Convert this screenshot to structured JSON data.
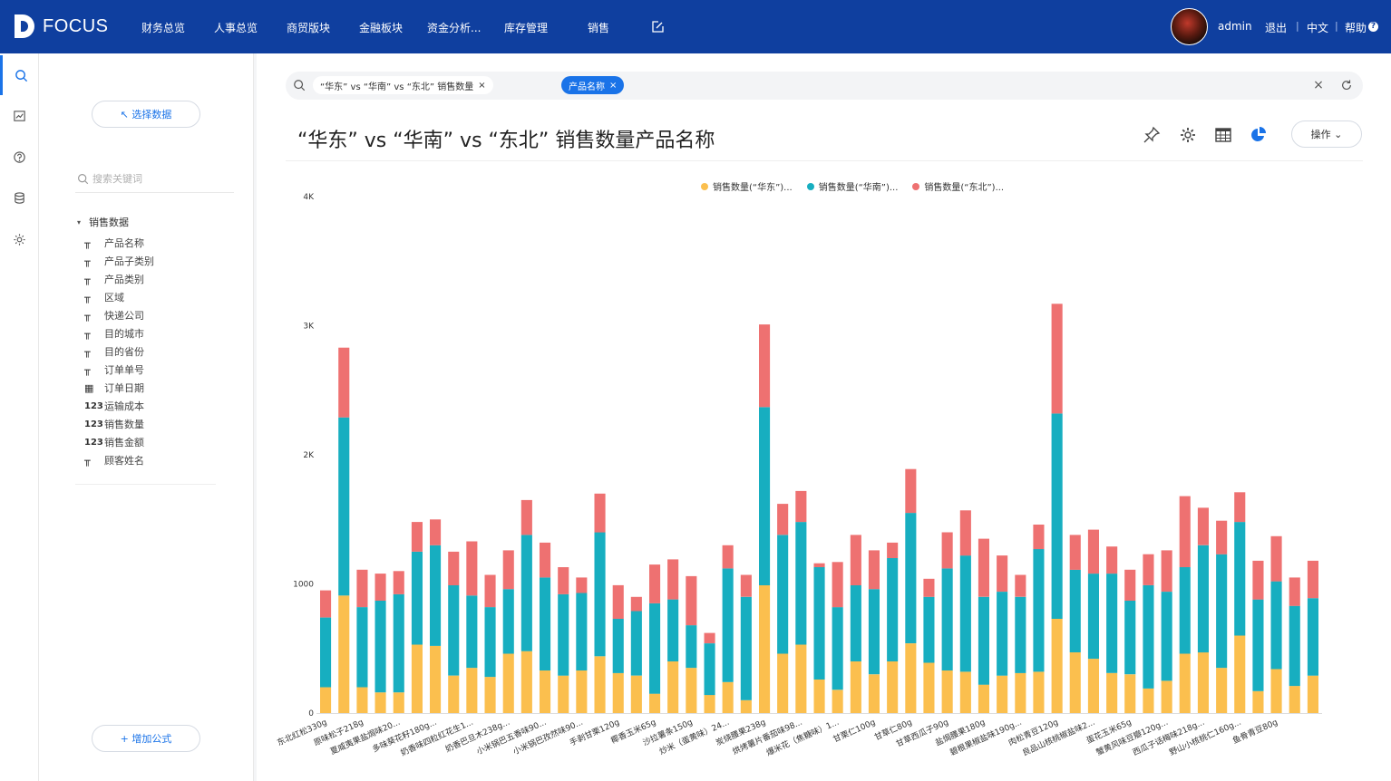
{
  "header": {
    "logo_text": "FOCUS",
    "nav": [
      "财务总览",
      "人事总览",
      "商贸版块",
      "金融板块",
      "资金分析...",
      "库存管理",
      "销售"
    ],
    "user": "admin",
    "logout": "退出",
    "language": "中文",
    "help": "帮助",
    "help_icon_glyph": "?"
  },
  "rail": [
    "search-icon",
    "dashboard-icon",
    "help-icon",
    "database-icon",
    "settings-icon"
  ],
  "panel": {
    "select_data": "↖ 选择数据",
    "search_placeholder": "搜索关键词",
    "group_caret": "▾",
    "group": "销售数据",
    "fields": [
      {
        "type": "╥",
        "label": "产品名称"
      },
      {
        "type": "╥",
        "label": "产品子类别"
      },
      {
        "type": "╥",
        "label": "产品类别"
      },
      {
        "type": "╥",
        "label": "区域"
      },
      {
        "type": "╥",
        "label": "快递公司"
      },
      {
        "type": "╥",
        "label": "目的城市"
      },
      {
        "type": "╥",
        "label": "目的省份"
      },
      {
        "type": "╥",
        "label": "订单单号"
      },
      {
        "type": "▦",
        "label": "订单日期"
      },
      {
        "type": "123",
        "label": "运输成本"
      },
      {
        "type": "123",
        "label": "销售数量"
      },
      {
        "type": "123",
        "label": "销售金额"
      },
      {
        "type": "╥",
        "label": "顾客姓名"
      }
    ],
    "add_formula": "+ 增加公式"
  },
  "query": {
    "chip1": "“华东” vs “华南” vs “东北”   销售数量",
    "chip2": "产品名称",
    "chip_close": "×",
    "clear": "×"
  },
  "title": "“华东” vs “华南” vs “东北”   销售数量产品名称",
  "toolbar": {
    "operate": "操作 ⌄"
  },
  "colors": {
    "east": "#fbbf4e",
    "south": "#17aec0",
    "northeast": "#ee7171",
    "accent": "#1a73e8",
    "header": "#0f3f9f"
  },
  "chart_data": {
    "type": "bar",
    "stacked": true,
    "ylim": [
      0,
      4000
    ],
    "yticks": [
      "0",
      "1000",
      "2K",
      "3K",
      "4K"
    ],
    "legend": [
      "销售数量(“华东”)...",
      "销售数量(“华南”)...",
      "销售数量(“东北”)..."
    ],
    "categories": [
      "东北红松330g",
      "原味松子218g",
      "夏威夷果盐焗味20...",
      "多味葵花籽180g...",
      "奶香味四粒红花生1...",
      "奶香巴旦木238g...",
      "小米锅巴五香味90...",
      "小米锅巴孜然味90...",
      "手剥甘栗120g",
      "椰香玉米65g",
      "沙拉薯条150g",
      "炒米（蛋黄味）24...",
      "炭烧腰果238g",
      "烘烤薯片番茄味98...",
      "爆米花（焦糖味）1...",
      "甘栗仁100g",
      "甘草仁80g",
      "甘草西瓜子90g",
      "盐焗腰果180g",
      "碧根果椒盐味190g...",
      "肉松青豆120g",
      "良品山核桃椒盐味2...",
      "蛋花玉米65g",
      "蟹黄风味豆瓣120g...",
      "西瓜子话梅味218g...",
      "野山小核桃仁160g...",
      "鱼骨青豆80g"
    ],
    "series": [
      {
        "name": "销售数量(“华东”)...",
        "values": [
          200,
          910,
          200,
          160,
          160,
          530,
          520,
          290,
          350,
          280,
          460,
          480,
          330,
          290,
          330,
          440,
          310,
          290,
          150,
          400,
          350,
          140,
          240,
          100,
          990,
          460,
          530,
          260,
          180,
          400,
          300,
          400,
          540,
          390,
          330,
          320,
          220,
          290,
          310,
          320,
          730,
          470,
          420,
          310,
          300,
          190,
          250,
          460,
          470,
          350,
          600,
          170,
          340,
          210,
          290
        ]
      },
      {
        "name": "销售数量(“华南”)...",
        "values": [
          540,
          1380,
          620,
          710,
          760,
          720,
          780,
          700,
          560,
          540,
          500,
          900,
          720,
          630,
          600,
          960,
          420,
          500,
          700,
          480,
          330,
          400,
          880,
          800,
          1380,
          920,
          950,
          870,
          640,
          590,
          660,
          800,
          1010,
          510,
          790,
          900,
          680,
          650,
          590,
          950,
          1590,
          640,
          660,
          770,
          570,
          800,
          690,
          670,
          830,
          880,
          880,
          710,
          680,
          620,
          600
        ]
      },
      {
        "name": "销售数量(“东北”)...",
        "values": [
          210,
          540,
          290,
          210,
          180,
          230,
          200,
          260,
          420,
          250,
          300,
          270,
          270,
          210,
          120,
          300,
          260,
          110,
          300,
          310,
          380,
          80,
          180,
          170,
          640,
          240,
          240,
          30,
          350,
          390,
          300,
          120,
          340,
          140,
          280,
          350,
          450,
          280,
          170,
          190,
          850,
          270,
          340,
          210,
          240,
          240,
          320,
          550,
          290,
          260,
          230,
          300,
          350,
          220,
          290
        ]
      }
    ]
  }
}
